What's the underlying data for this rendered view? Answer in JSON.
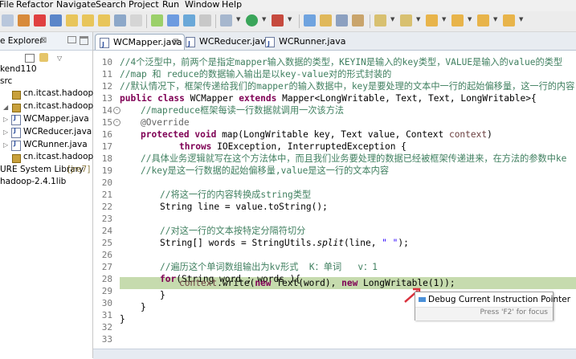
{
  "menubar": [
    "File",
    "Refactor",
    "Navigate",
    "Search",
    "Project",
    "Run",
    "Window",
    "Help"
  ],
  "left_panel": {
    "tab_label": "e Explorer",
    "tab_close": "⊠",
    "items": {
      "project": "kend110",
      "src": "src",
      "pkg_hdfs": "cn.itcast.hadoop.hdfs",
      "pkg_mr": "cn.itcast.hadoop.mr.w",
      "file1": "WCMapper.java",
      "file2": "WCReducer.java",
      "file3": "WCRunner.java",
      "pkg_rpc": "cn.itcast.hadoop.rpc",
      "jre": "URE System Library",
      "jre_version": "[jre7]",
      "lib": "hadoop-2.4.1lib"
    }
  },
  "editor": {
    "tabs": [
      {
        "label": "WCMapper.java",
        "close": "⊠"
      },
      {
        "label": "WCReducer.java"
      },
      {
        "label": "WCRunner.java"
      }
    ]
  },
  "code": {
    "line_numbers": [
      "10",
      "11",
      "12",
      "13",
      "14",
      "15",
      "16",
      "17",
      "18",
      "19",
      "20",
      "21",
      "22",
      "23",
      "24",
      "25",
      "26",
      "27",
      "28",
      "29",
      "30",
      "31",
      "32",
      "33"
    ],
    "l10": "//4个泛型中，前两个是指定mapper输入数据的类型，KEYIN是输入的key类型，VALUE是输入的value的类型",
    "l11": "//map 和 reduce的数据输入输出是以key-value对的形式封装的",
    "l12": "//默认情况下，框架传递给我们的mapper的输入数据中，key是要处理的文本中一行的起始偏移量，这一行的内容",
    "l13_kw1": "public",
    "l13_kw2": "class",
    "l13_name": " WCMapper ",
    "l13_kw3": "extends",
    "l13_rest": " Mapper<LongWritable, Text, Text, LongWritable>{",
    "l14": "//mapreduce框架每读一行数据就调用一次该方法",
    "l15": "@Override",
    "l16_kw1": "protected",
    "l16_kw2": "void",
    "l16_rest": " map(LongWritable key, Text value, Context ",
    "l16_ctx": "context",
    "l16_end": ")",
    "l17_kw": "throws",
    "l17_rest": " IOException, InterruptedException {",
    "l18": "//具体业务逻辑就写在这个方法体中，而且我们业务要处理的数据已经被框架传递进来，在方法的参数中ke",
    "l19": "//key是这一行数据的起始偏移量,value是这一行的文本内容",
    "l21": "//将这一行的内容转换成string类型",
    "l22": "String line = value.toString();",
    "l24": "//对这一行的文本按特定分隔符切分",
    "l25_a": "String[] words = StringUtils.",
    "l25_b": "split",
    "l25_c": "(line, ",
    "l25_d": "\" \"",
    "l25_e": ");",
    "l27": "//遍历这个单词数组输出为kv形式  K：单词   v：1",
    "l28_kw": "for",
    "l28_rest": "(String word : words ){",
    "l29_a": "context",
    "l29_b": ".write(",
    "l29_kw1": "new",
    "l29_c": " Text(word), ",
    "l29_kw2": "new",
    "l29_d": " LongWritable(1));",
    "l30": "}",
    "l31": "}",
    "l32": "}"
  },
  "tooltip": {
    "title": "Debug Current Instruction Pointer",
    "subtitle": "Press 'F2' for focus"
  },
  "colors": {
    "comment": "#3f7f5f",
    "keyword": "#7f0055",
    "string": "#2a00ff",
    "current_line": "#c6dbae"
  }
}
